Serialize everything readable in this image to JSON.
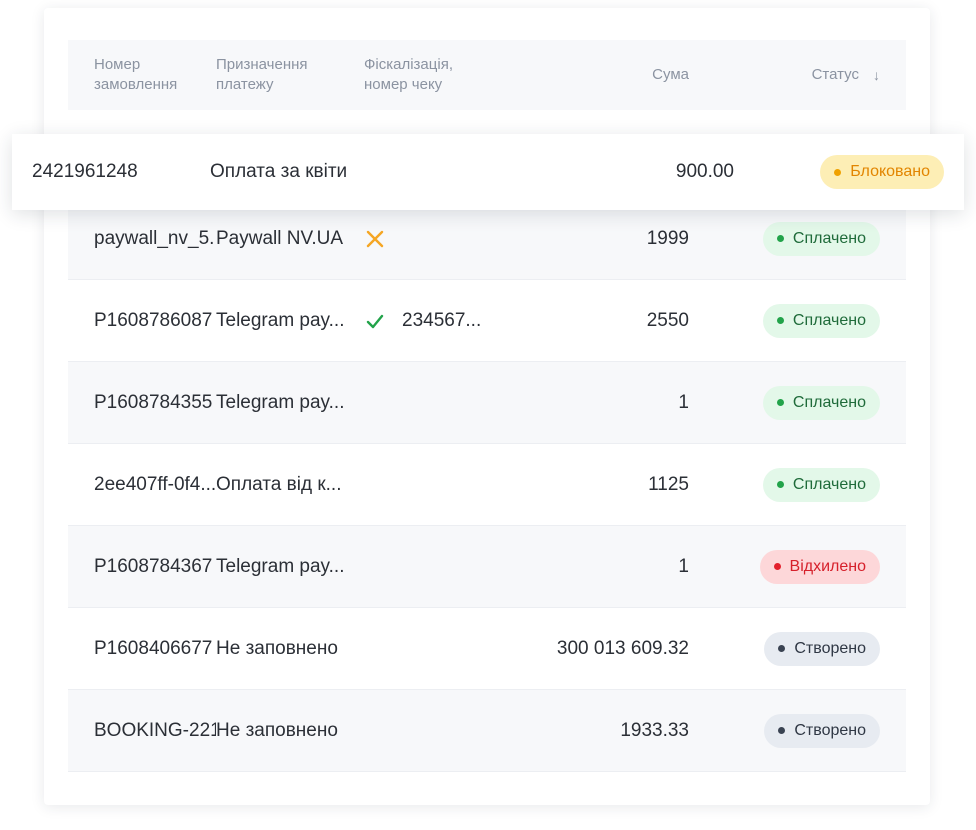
{
  "table": {
    "headers": {
      "order": "Номер\nзамовлення",
      "purpose": "Призначення\nплатежу",
      "fiscal": "Фіскалізація,\nномер чеку",
      "sum": "Сума",
      "status": "Статус",
      "sort_icon": "sort-desc-arrow-icon"
    },
    "highlighted_row": {
      "order": "2421961248",
      "purpose": "Оплата за квіти",
      "sum": "900.00",
      "status": "Блоковано"
    },
    "rows": [
      {
        "order": "paywall_nv_5...",
        "purpose": "Paywall NV.UA",
        "fiscal_icon": "cross-icon",
        "fiscal_number": "",
        "sum": "1999",
        "status": "Сплачено"
      },
      {
        "order": "P1608786087",
        "purpose": "Telegram pay...",
        "fiscal_icon": "check-icon",
        "fiscal_number": "234567...",
        "sum": "2550",
        "status": "Сплачено"
      },
      {
        "order": "P1608784355",
        "purpose": "Telegram pay...",
        "fiscal_icon": "",
        "fiscal_number": "",
        "sum": "1",
        "status": "Сплачено"
      },
      {
        "order": "2ee407ff-0f4...",
        "purpose": "Оплата від к...",
        "fiscal_icon": "",
        "fiscal_number": "",
        "sum": "1125",
        "status": "Сплачено"
      },
      {
        "order": "P1608784367",
        "purpose": "Telegram pay...",
        "fiscal_icon": "",
        "fiscal_number": "",
        "sum": "1",
        "status": "Відхилено"
      },
      {
        "order": "P1608406677",
        "purpose": "Не заповнено",
        "fiscal_icon": "",
        "fiscal_number": "",
        "sum": "300 013 609.32",
        "status": "Створено"
      },
      {
        "order": "BOOKING-221",
        "purpose": "Не заповнено",
        "fiscal_icon": "",
        "fiscal_number": "",
        "sum": "1933.33",
        "status": "Створено"
      }
    ]
  },
  "colors": {
    "status_paid": "#22a34a",
    "status_declined": "#e3202c",
    "status_created": "#3a4352",
    "status_blocked": "#f0a100",
    "fiscal_cross": "#f5a623",
    "fiscal_check": "#22a34a"
  }
}
